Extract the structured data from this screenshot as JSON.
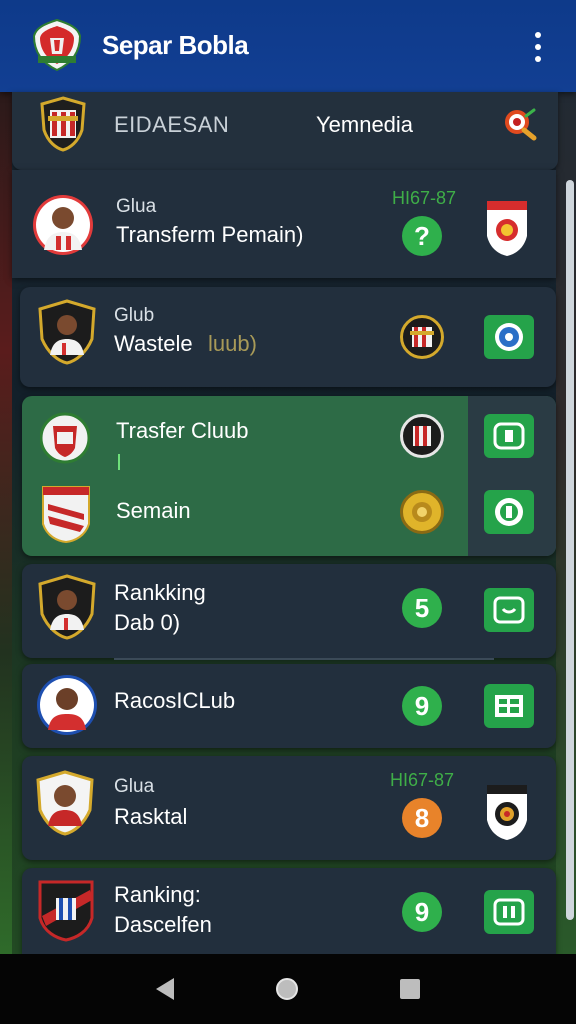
{
  "app": {
    "title": "Separ Bobla"
  },
  "header": {
    "tab_a": "EIDAESAN",
    "tab_b": "Yemnedia"
  },
  "rows": [
    {
      "small": "Glua",
      "main": "Transferm Pemain)",
      "code": "HI67-87",
      "badge": "?"
    },
    {
      "small": "Glub",
      "main": "Wastele",
      "main_extra": "luub)"
    },
    {
      "main": "Trasfer Cluub",
      "main2": "Semain"
    },
    {
      "main": "Rankking",
      "main2": "Dab 0)",
      "badge": "5"
    },
    {
      "main": "RacosICLub",
      "badge": "9"
    },
    {
      "small": "Glua",
      "main": "Rasktal",
      "code": "HI67-87",
      "badge": "8"
    },
    {
      "main": "Ranking:",
      "main2": "Dascelfen",
      "badge": "9"
    }
  ],
  "colors": {
    "accent_green": "#25a34a",
    "appbar_blue": "#123f93",
    "badge_orange": "#e8832a"
  }
}
